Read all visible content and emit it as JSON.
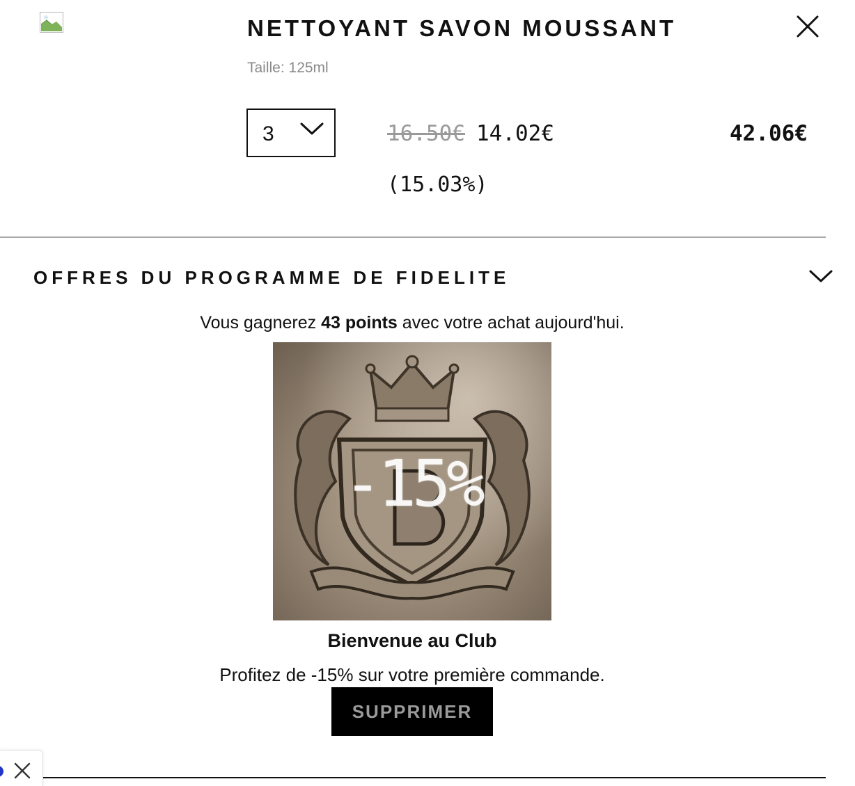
{
  "product": {
    "name": "NETTOYANT SAVON MOUSSANT",
    "size_text": "Taille: 125ml",
    "quantity": "3",
    "price_original": "16.50€",
    "price_discounted": "14.02€",
    "discount_percent": "(15.03%)",
    "line_total": "42.06€"
  },
  "loyalty": {
    "title": "OFFRES DU PROGRAMME DE FIDELITE",
    "earn_prefix": "Vous gagnerez ",
    "earn_points": "43 points",
    "earn_suffix": " avec votre achat aujourd'hui.",
    "image_badge": "-15%",
    "offer_title": "Bienvenue au Club",
    "offer_description": "Profitez de -15% sur votre première commande.",
    "remove_button": "SUPPRIMER"
  },
  "colors": {
    "text": "#111111",
    "muted": "#8a8a8a",
    "button_bg": "#000000",
    "button_text": "#9a9a9a",
    "accent_blue": "#2136c7"
  },
  "icons": {
    "close": "close-icon",
    "quantity_dropdown": "chevron-down-icon",
    "section_toggle": "chevron-down-icon",
    "broken_image": "broken-image-icon"
  }
}
